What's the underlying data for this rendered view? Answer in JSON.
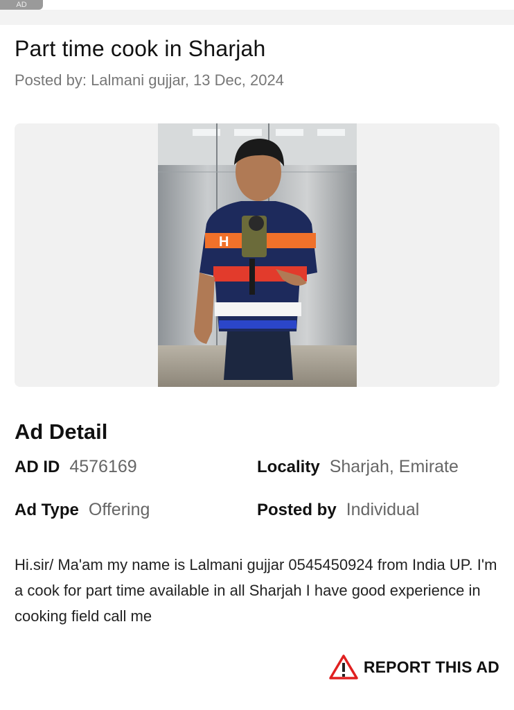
{
  "top": {
    "badge": "AD"
  },
  "listing": {
    "title": "Part time cook in Sharjah",
    "posted_line": "Posted by: Lalmani gujjar, 13 Dec, 2024"
  },
  "details": {
    "heading": "Ad Detail",
    "ad_id_label": "AD ID",
    "ad_id_value": "4576169",
    "locality_label": "Locality",
    "locality_value": "Sharjah, Emirate",
    "ad_type_label": "Ad Type",
    "ad_type_value": "Offering",
    "posted_by_label": "Posted by",
    "posted_by_value": "Individual"
  },
  "description": "Hi.sir/ Ma'am my name is Lalmani gujjar 0545450924 from India UP. I'm a cook for part time available in all Sharjah I have good experience in cooking field call me",
  "report": {
    "label": "REPORT THIS AD",
    "icon": "warning-triangle-icon"
  },
  "colors": {
    "warning_red": "#e02020",
    "text_muted": "#777777"
  }
}
